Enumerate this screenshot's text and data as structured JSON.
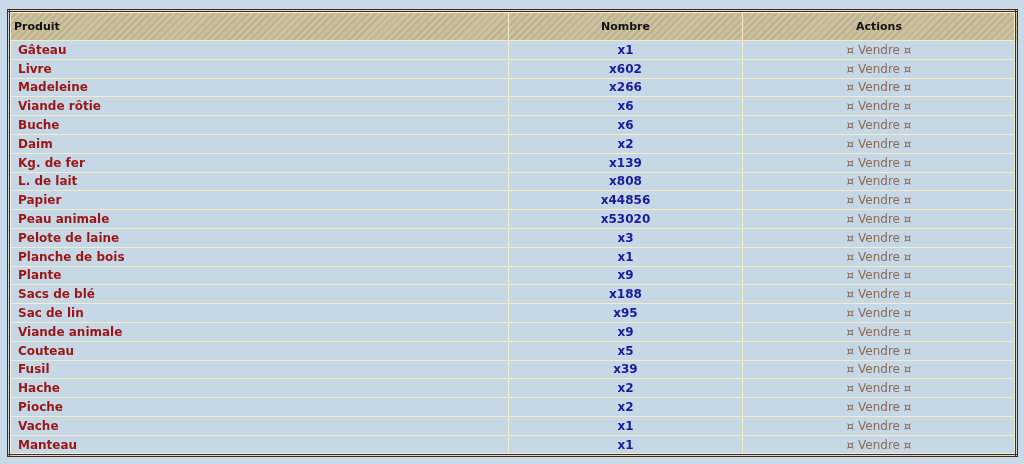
{
  "table": {
    "columns": [
      "Produit",
      "Nombre",
      "Actions"
    ],
    "rows": [
      {
        "product": "Gâteau",
        "count": "x1",
        "action": "¤ Vendre ¤"
      },
      {
        "product": "Livre",
        "count": "x602",
        "action": "¤ Vendre ¤"
      },
      {
        "product": "Madeleine",
        "count": "x266",
        "action": "¤ Vendre ¤"
      },
      {
        "product": "Viande rôtie",
        "count": "x6",
        "action": "¤ Vendre ¤"
      },
      {
        "product": "Buche",
        "count": "x6",
        "action": "¤ Vendre ¤"
      },
      {
        "product": "Daim",
        "count": "x2",
        "action": "¤ Vendre ¤"
      },
      {
        "product": "Kg. de fer",
        "count": "x139",
        "action": "¤ Vendre ¤"
      },
      {
        "product": "L. de lait",
        "count": "x808",
        "action": "¤ Vendre ¤"
      },
      {
        "product": "Papier",
        "count": "x44856",
        "action": "¤ Vendre ¤"
      },
      {
        "product": "Peau animale",
        "count": "x53020",
        "action": "¤ Vendre ¤"
      },
      {
        "product": "Pelote de laine",
        "count": "x3",
        "action": "¤ Vendre ¤"
      },
      {
        "product": "Planche de bois",
        "count": "x1",
        "action": "¤ Vendre ¤"
      },
      {
        "product": "Plante",
        "count": "x9",
        "action": "¤ Vendre ¤"
      },
      {
        "product": "Sacs de blé",
        "count": "x188",
        "action": "¤ Vendre ¤"
      },
      {
        "product": "Sac de lin",
        "count": "x95",
        "action": "¤ Vendre ¤"
      },
      {
        "product": "Viande animale",
        "count": "x9",
        "action": "¤ Vendre ¤"
      },
      {
        "product": "Couteau",
        "count": "x5",
        "action": "¤ Vendre ¤"
      },
      {
        "product": "Fusil",
        "count": "x39",
        "action": "¤ Vendre ¤"
      },
      {
        "product": "Hache",
        "count": "x2",
        "action": "¤ Vendre ¤"
      },
      {
        "product": "Pioche",
        "count": "x2",
        "action": "¤ Vendre ¤"
      },
      {
        "product": "Vache",
        "count": "x1",
        "action": "¤ Vendre ¤"
      },
      {
        "product": "Manteau",
        "count": "x1",
        "action": "¤ Vendre ¤"
      }
    ]
  }
}
